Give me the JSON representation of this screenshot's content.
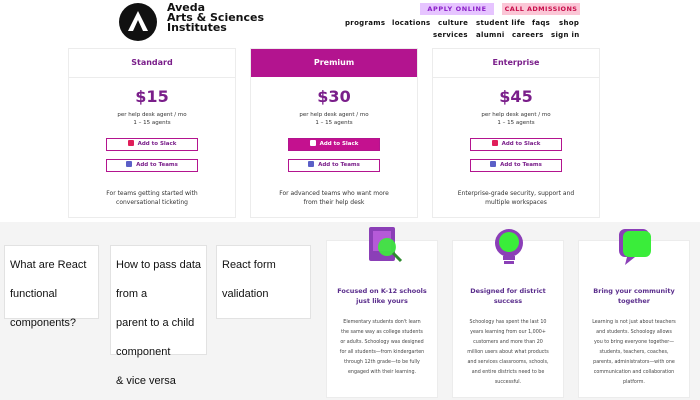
{
  "header": {
    "brand_line1": "Aveda",
    "brand_line2": "Arts & Sciences",
    "brand_line3": "Institutes",
    "apply_label": "APPLY ONLINE",
    "call_label": "CALL ADMISSIONS",
    "nav_row1": [
      "programs",
      "locations",
      "culture",
      "student life",
      "faqs",
      "shop"
    ],
    "nav_row2": [
      "services",
      "alumni",
      "careers",
      "sign in"
    ]
  },
  "pricing": {
    "plans": [
      {
        "name": "Standard",
        "price": "$15",
        "per_line1": "per help desk agent / mo",
        "per_line2": "1 – 15 agents",
        "slack": "Add to Slack",
        "teams": "Add to Teams",
        "desc_line1": "For teams getting started with",
        "desc_line2": "conversational ticketing"
      },
      {
        "name": "Premium",
        "price": "$30",
        "per_line1": "per help desk agent / mo",
        "per_line2": "1 – 15 agents",
        "slack": "Add to Slack",
        "teams": "Add to Teams",
        "desc_line1": "For advanced teams who want more",
        "desc_line2": "from their help desk"
      },
      {
        "name": "Enterprise",
        "price": "$45",
        "per_line1": "per help desk agent / mo",
        "per_line2": "1 – 15 agents",
        "slack": "Add to Slack",
        "teams": "Add to Teams",
        "desc_line1": "Enterprise-grade security, support and",
        "desc_line2": "multiple workspaces"
      }
    ]
  },
  "articles": [
    {
      "line1": "What are React functional",
      "line2": "components?"
    },
    {
      "line1": "How to pass data from a",
      "line2": "parent to a child component",
      "line3": "& vice versa"
    },
    {
      "line1": "React form validation"
    }
  ],
  "features": [
    {
      "title_line1": "Focused on K-12 schools",
      "title_line2": "just like yours",
      "body": [
        "Elementary students don't learn",
        "the same way as college students",
        "or adults. Schoology was designed",
        "for all students—from kindergarten",
        "through 12th grade—to be fully",
        "engaged with their learning."
      ]
    },
    {
      "title_line1": "Designed for district",
      "title_line2": "success",
      "body": [
        "Schoology has spent the last 10",
        "years learning from our 1,000+",
        "customers and more than 20",
        "million users about what products",
        "and services classrooms, schools,",
        "and entire districts need to be",
        "successful."
      ]
    },
    {
      "title_line1": "Bring your community",
      "title_line2": "together",
      "body": [
        "Learning is not just about teachers",
        "and students. Schoology allows",
        "you to bring everyone together—",
        "students, teachers, coaches,",
        "parents, administrators—with one",
        "communication and collaboration",
        "platform."
      ]
    }
  ],
  "colors": {
    "accent": "#b3148f",
    "purple": "#7a1e8a",
    "apply_bg": "#e6c4ff",
    "call_bg": "#fbc6d6"
  }
}
